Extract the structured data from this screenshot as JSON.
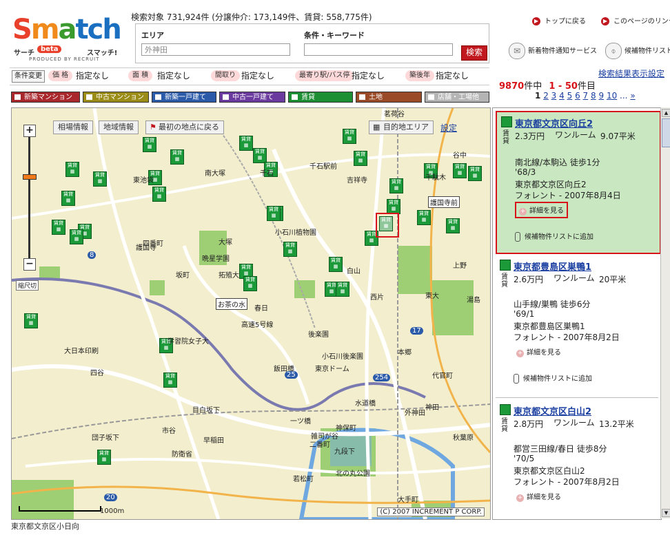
{
  "header": {
    "logo_word": [
      "S",
      "m",
      "a",
      "tch"
    ],
    "logo_left": "サーチ",
    "logo_beta": "beta",
    "logo_right": "スマッチ!",
    "logo_produced": "PRODUCED BY RECRUIT",
    "count_line": "検索対象 731,924件 (分譲仲介: 173,149件、賃貸: 558,775件)",
    "area_label": "エリア",
    "area_value": "外神田",
    "keyword_label": "条件・キーワード",
    "keyword_value": "",
    "search_button": "検索",
    "link_top": "トップに戻る",
    "link_this_page": "このページのリンク",
    "notify_service": "新着物件通知サービス",
    "candidate_list": "候補物件リスト"
  },
  "filters": {
    "change": "条件変更",
    "items": [
      {
        "tag": "価 格",
        "value": "指定なし"
      },
      {
        "tag": "面 積",
        "value": "指定なし"
      },
      {
        "tag": "間取り",
        "value": "指定なし"
      },
      {
        "tag": "最寄り駅/バス停",
        "value": "指定なし"
      },
      {
        "tag": "築後年",
        "value": "指定なし"
      }
    ]
  },
  "categories": [
    {
      "label": "新築マンション",
      "color": "#a8282c"
    },
    {
      "label": "中古マンション",
      "color": "#9a8c16"
    },
    {
      "label": "新築一戸建て",
      "color": "#2a5aa8"
    },
    {
      "label": "中古一戸建て",
      "color": "#6a3a9e"
    },
    {
      "label": "賃貸",
      "color": "#1c8e34"
    },
    {
      "label": "土地",
      "color": "#9a4a26"
    },
    {
      "label": "店舗・工場他",
      "color": "#b4b4b4"
    }
  ],
  "map": {
    "btn_market": "相場情報",
    "btn_area_info": "地域情報",
    "btn_back_initial": "最初の地点に戻る",
    "btn_destination": "目的地エリア",
    "btn_settings": "設定",
    "scale_button": "縮尺切",
    "scale_text": "1000m",
    "copyright": "(C) 2007 INCREMENT P CORP.",
    "pin_label": "賃貸",
    "status": "東京都文京区小日向",
    "labels": [
      "東池袋",
      "大塚",
      "南大塚",
      "千石",
      "千石駅前",
      "吉祥寺",
      "千駄木",
      "谷中",
      "小石川植物園",
      "護国寺",
      "拓殖大",
      "春日",
      "白山",
      "西片",
      "本郷",
      "東大",
      "上野",
      "湯島",
      "後楽園",
      "飯田橋",
      "東京ドーム",
      "小石川後楽園",
      "神田",
      "外神田",
      "秋葉原",
      "水道橋",
      "神保町",
      "一ツ橋",
      "大手町",
      "北の丸公園",
      "九段下",
      "市谷",
      "四谷",
      "早稲田",
      "学習院女子大",
      "大日本印刷",
      "防衛省",
      "団子坂下",
      "目白坂下",
      "雑司が谷",
      "茗荷谷",
      "護国寺前",
      "お茶の水",
      "晩星学園",
      "坂町",
      "四番町",
      "代官町",
      "二番町",
      "若松町"
    ],
    "road_labels": [
      "高速5号線",
      "254",
      "17",
      "25",
      "20",
      "8"
    ]
  },
  "results": {
    "display_settings": "検索結果表示設定",
    "total": "9870",
    "range": "1 - 50",
    "total_suffix": "件中",
    "range_suffix": "件目",
    "pages": [
      "1",
      "2",
      "3",
      "4",
      "5",
      "6",
      "7",
      "8",
      "9",
      "10",
      "...",
      "»"
    ],
    "detail_label": "詳細を見る",
    "add_label": "候補物件リストに追加",
    "kind": "賃貸",
    "cards": [
      {
        "title": "東京都文京区向丘2",
        "price": "2.3万円",
        "type": "ワンルーム",
        "area": "9.07平米",
        "station": "南北線/本駒込 徒歩1分",
        "built": "'68/3",
        "address": "東京都文京区向丘2",
        "agent": "フォレント - 2007年8月4日"
      },
      {
        "title": "東京都豊島区巣鴨1",
        "price": "2.6万円",
        "type": "ワンルーム",
        "area": "20平米",
        "station": "山手線/巣鴨 徒歩6分",
        "built": "'69/1",
        "address": "東京都豊島区巣鴨1",
        "agent": "フォレント - 2007年8月2日"
      },
      {
        "title": "東京都文京区白山2",
        "price": "2.8万円",
        "type": "ワンルーム",
        "area": "13.2平米",
        "station": "都営三田線/春日 徒歩8分",
        "built": "'70/5",
        "address": "東京都文京区白山2",
        "agent": "フォレント - 2007年8月2日"
      }
    ]
  }
}
